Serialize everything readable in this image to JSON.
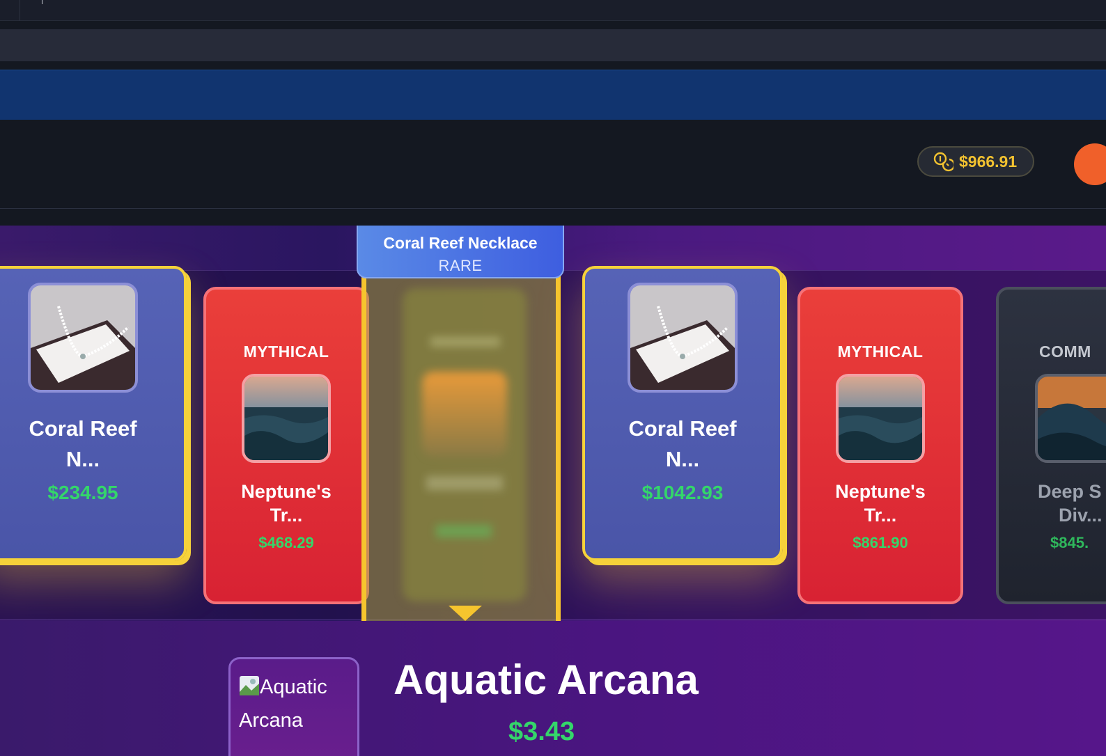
{
  "header": {
    "balance": "$966.91",
    "balance_icon": "coins-icon",
    "colors": {
      "accent": "#f2c230",
      "avatar": "#f0602a"
    }
  },
  "reel": {
    "winner": {
      "name": "Coral Reef Necklace",
      "rarity": "RARE"
    },
    "cards": [
      {
        "rarity": "",
        "name_line1": "Coral Reef",
        "name_line2": "N...",
        "price": "$234.95",
        "image": "pearl-necklace"
      },
      {
        "rarity": "MYTHICAL",
        "name_line1": "Neptune's",
        "name_line2": "Tr...",
        "price": "$468.29",
        "image": "ocean-waves"
      },
      {
        "rarity": "",
        "name_line1": "Coral Reef",
        "name_line2": "N...",
        "price": "$1042.93",
        "image": "pearl-necklace"
      },
      {
        "rarity": "MYTHICAL",
        "name_line1": "Neptune's",
        "name_line2": "Tr...",
        "price": "$861.90",
        "image": "ocean-waves"
      },
      {
        "rarity": "COMM",
        "name_line1": "Deep S",
        "name_line2": "Div...",
        "price": "$845.",
        "image": "sunset-wave"
      }
    ],
    "colors": {
      "rare": "#4a55a8",
      "mythical": "#d82233",
      "common": "#1f232e",
      "selector": "#f6c52e",
      "price": "#34d66a"
    }
  },
  "case": {
    "image_alt": "Aquatic Arcana",
    "title": "Aquatic Arcana",
    "price": "$3.43"
  }
}
